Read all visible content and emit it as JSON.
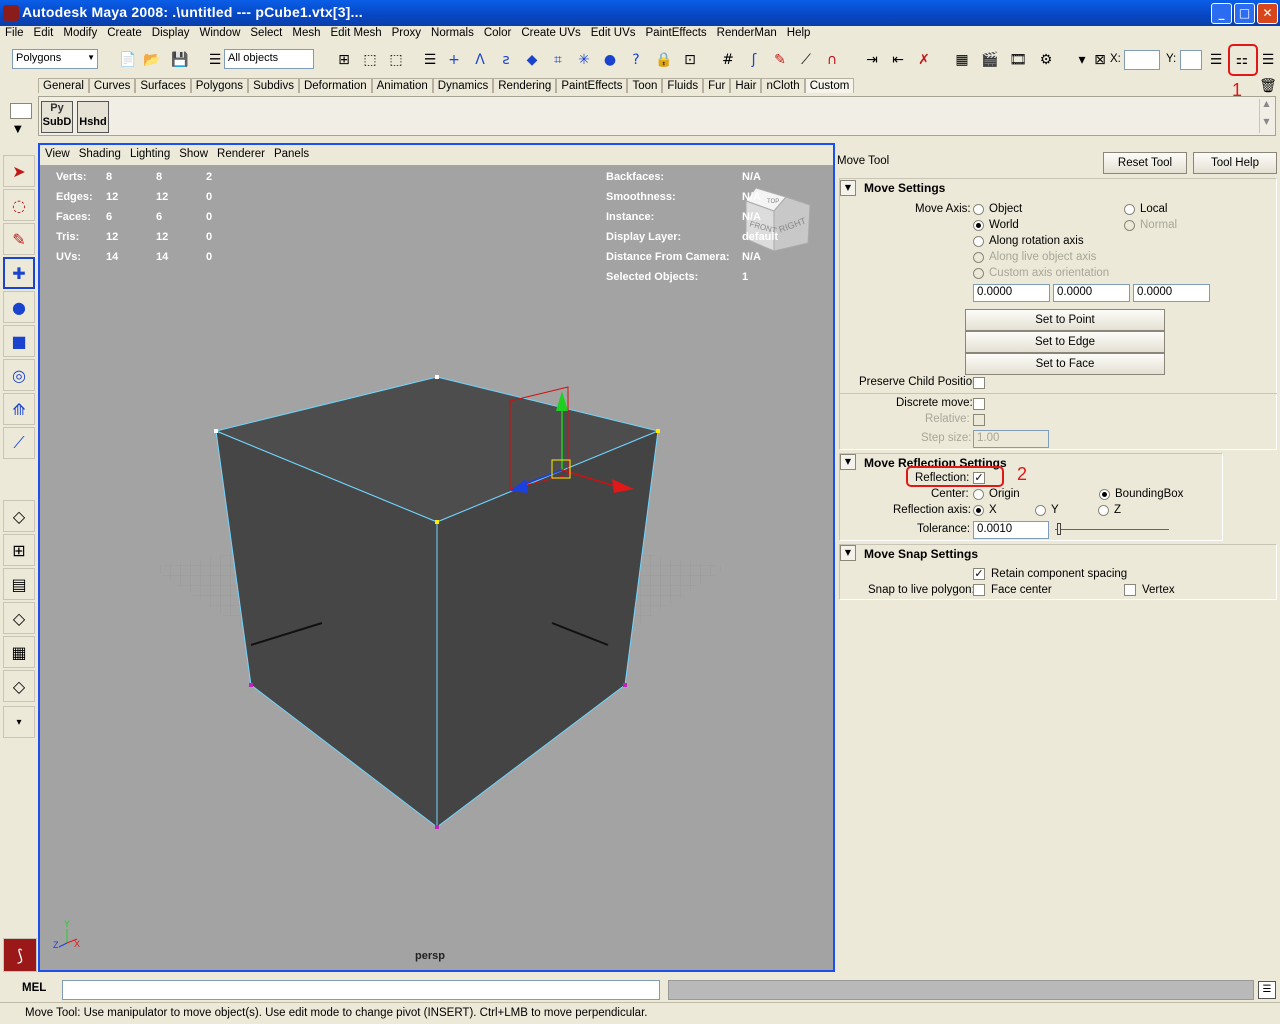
{
  "window": {
    "title": "Autodesk Maya 2008: .\\untitled   ---   pCube1.vtx[3]...",
    "minimize": "_",
    "maximize": "□",
    "close": "✕"
  },
  "menus": [
    "File",
    "Edit",
    "Modify",
    "Create",
    "Display",
    "Window",
    "Select",
    "Mesh",
    "Edit Mesh",
    "Proxy",
    "Normals",
    "Color",
    "Create UVs",
    "Edit UVs",
    "PaintEffects",
    "RenderMan",
    "Help"
  ],
  "toolbar": {
    "mode_select": "Polygons",
    "selection_mask": "All objects",
    "x_label": "X:",
    "y_label": "Y:"
  },
  "shelf_tabs": [
    "General",
    "Curves",
    "Surfaces",
    "Polygons",
    "Subdivs",
    "Deformation",
    "Animation",
    "Dynamics",
    "Rendering",
    "PaintEffects",
    "Toon",
    "Fluids",
    "Fur",
    "Hair",
    "nCloth",
    "Custom"
  ],
  "shelf_active_tab": "Custom",
  "shelf_buttons": [
    {
      "top": "Py",
      "bottom": "SubD"
    },
    {
      "top": "",
      "bottom": "Hshd"
    }
  ],
  "viewport": {
    "menu": [
      "View",
      "Shading",
      "Lighting",
      "Show",
      "Renderer",
      "Panels"
    ],
    "camera_label": "persp",
    "view_cube": {
      "top": "TOP",
      "front": "FRONT",
      "right": "RIGHT"
    },
    "hud_left": [
      {
        "label": "Verts:",
        "v1": "8",
        "v2": "8",
        "v3": "2"
      },
      {
        "label": "Edges:",
        "v1": "12",
        "v2": "12",
        "v3": "0"
      },
      {
        "label": "Faces:",
        "v1": "6",
        "v2": "6",
        "v3": "0"
      },
      {
        "label": "Tris:",
        "v1": "12",
        "v2": "12",
        "v3": "0"
      },
      {
        "label": "UVs:",
        "v1": "14",
        "v2": "14",
        "v3": "0"
      }
    ],
    "hud_right": [
      {
        "label": "Backfaces:",
        "value": "N/A"
      },
      {
        "label": "Smoothness:",
        "value": "N/A"
      },
      {
        "label": "Instance:",
        "value": "N/A"
      },
      {
        "label": "Display Layer:",
        "value": "default"
      },
      {
        "label": "Distance From Camera:",
        "value": "N/A"
      },
      {
        "label": "Selected Objects:",
        "value": "1"
      }
    ],
    "axis_y": "Y",
    "axis_z": "Z",
    "axis_x": "X"
  },
  "tool_panel": {
    "tool_name": "Move Tool",
    "reset_button": "Reset Tool",
    "help_button": "Tool Help",
    "move_settings": {
      "title": "Move Settings",
      "move_axis_label": "Move Axis:",
      "axis_options": [
        "Object",
        "World",
        "Along rotation axis",
        "Along live object axis",
        "Custom axis orientation"
      ],
      "axis_options_right": [
        "Local",
        "Normal"
      ],
      "selected_axis": "World",
      "values": [
        "0.0000",
        "0.0000",
        "0.0000"
      ],
      "set_to_point": "Set to Point",
      "set_to_edge": "Set to Edge",
      "set_to_face": "Set to Face",
      "preserve_child": "Preserve Child Position",
      "discrete_move": "Discrete move:",
      "relative": "Relative:",
      "step_size_label": "Step size:",
      "step_size": "1.00"
    },
    "reflection_settings": {
      "title": "Move Reflection Settings",
      "reflection_label": "Reflection:",
      "reflection_checked": true,
      "center_label": "Center:",
      "center_options": [
        "Origin",
        "BoundingBox"
      ],
      "center_selected": "BoundingBox",
      "axis_label": "Reflection axis:",
      "axis_options": [
        "X",
        "Y",
        "Z"
      ],
      "axis_selected": "X",
      "tolerance_label": "Tolerance:",
      "tolerance": "0.0010"
    },
    "snap_settings": {
      "title": "Move Snap Settings",
      "retain_spacing": "Retain component spacing",
      "retain_checked": true,
      "snap_live_label": "Snap to live polygon:",
      "face_center": "Face center",
      "vertex": "Vertex"
    }
  },
  "annotations": {
    "mark1": "1",
    "mark2": "2"
  },
  "command_line": {
    "label": "MEL"
  },
  "status_line": "Move Tool: Use manipulator to move object(s). Use edit mode to change pivot (INSERT).  Ctrl+LMB to move perpendicular."
}
